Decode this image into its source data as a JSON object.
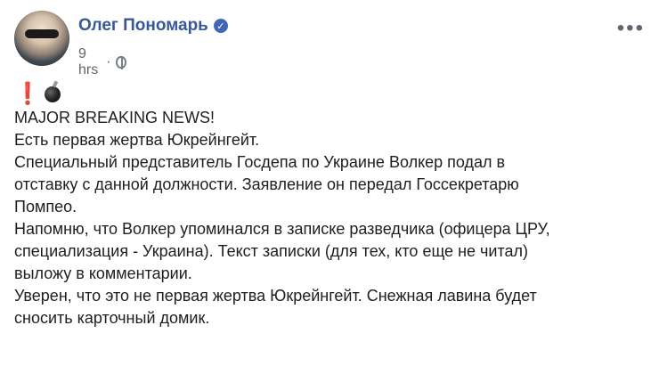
{
  "post": {
    "author": "Олег Пономарь",
    "time": "9 hrs",
    "visibility_icon": "globe-icon",
    "verified_icon": "verified-badge-icon",
    "more_icon": "more-options-icon",
    "emojis": [
      "❗",
      "💣"
    ],
    "lines": [
      "MAJOR BREAKING NEWS!",
      "Есть первая жертва Юкрейнгейт.",
      "Специальный представитель Госдепа по Украине Волкер подал в",
      "отставку с данной должности. Заявление он передал Госсекретарю",
      "Помпео.",
      "Напомню, что Волкер упоминался в записке разведчика (офицера ЦРУ,",
      "специализация - Украина). Текст записки (для тех, кто еще не читал)",
      "выложу в комментарии.",
      "Уверен, что это не первая жертва Юкрейнгейт. Снежная лавина будет",
      "сносить карточный домик."
    ]
  },
  "colors": {
    "author": "#385898",
    "meta": "#606770",
    "text": "#1c1e21",
    "verified": "#4267b2"
  }
}
